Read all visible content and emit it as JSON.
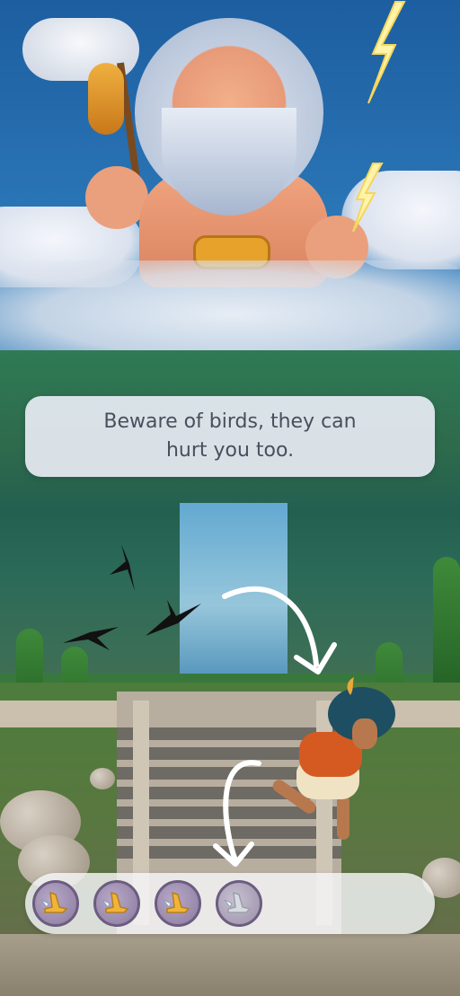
{
  "dialog": {
    "message": "Beware of birds, they can hurt you too."
  },
  "inventory": {
    "items": [
      {
        "name": "winged-sandal",
        "state": "filled",
        "icon": "winged-sandal-icon",
        "color": "#f0b43a"
      },
      {
        "name": "winged-sandal",
        "state": "filled",
        "icon": "winged-sandal-icon",
        "color": "#f0b43a"
      },
      {
        "name": "winged-sandal",
        "state": "filled",
        "icon": "winged-sandal-icon",
        "color": "#f0b43a"
      },
      {
        "name": "winged-sandal",
        "state": "empty",
        "icon": "winged-sandal-icon",
        "color": "#d8dbe2"
      }
    ]
  },
  "colors": {
    "dialog_bg": "#e8ecf4",
    "dialog_text": "#4a4f5c",
    "arrow": "#ffffff",
    "bird": "#111111"
  }
}
